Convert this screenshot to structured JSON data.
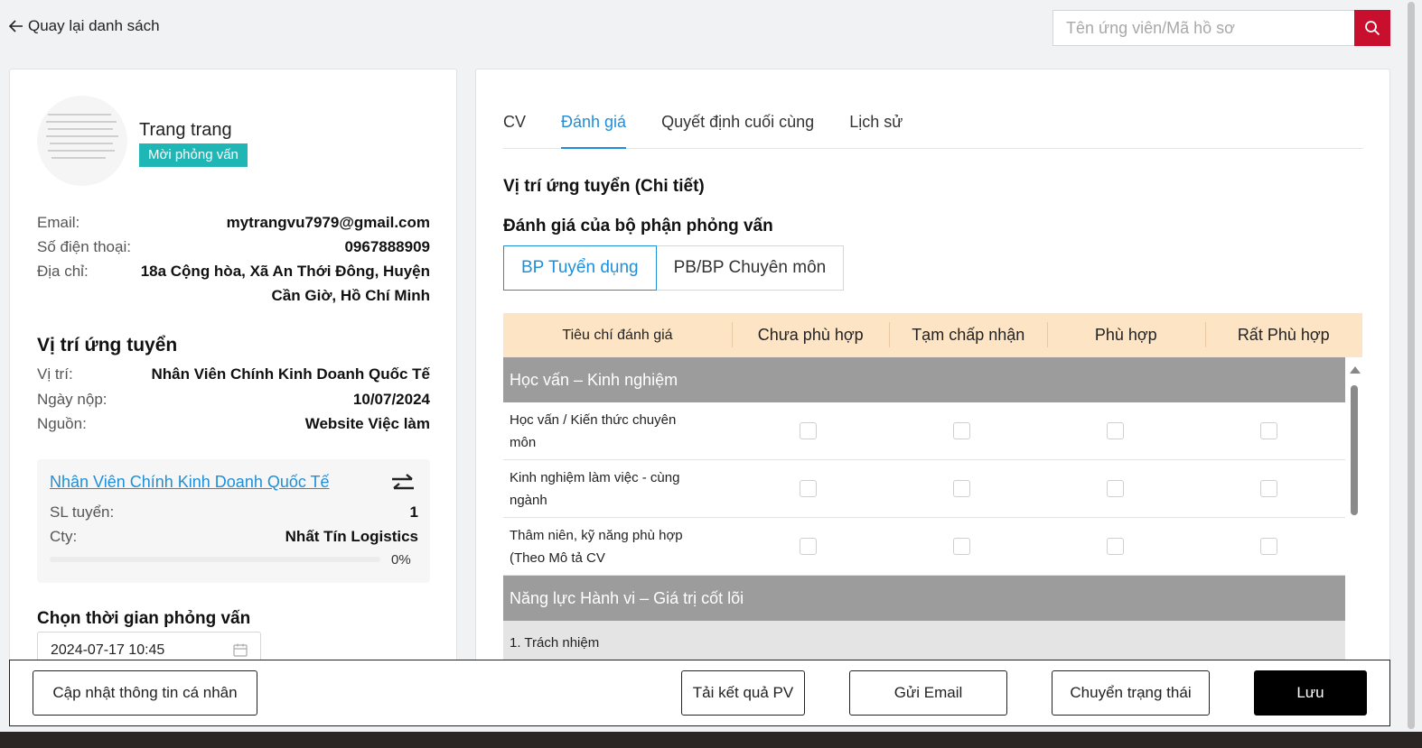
{
  "header": {
    "back_label": "Quay lại danh sách",
    "search_placeholder": "Tên ứng viên/Mã hồ sơ"
  },
  "candidate": {
    "name": "Trang trang",
    "status": "Mời phỏng vấn",
    "email_label": "Email:",
    "email": "mytrangvu7979@gmail.com",
    "phone_label": "Số điện thoại:",
    "phone": "0967888909",
    "address_label": "Địa chỉ:",
    "address_line1": "18a Cộng hòa, Xã An Thới Đông, Huyện",
    "address_line2": "Cần Giờ, Hồ Chí Minh"
  },
  "position": {
    "title": "Vị trí ứng tuyển",
    "role_label": "Vị trí:",
    "role": "Nhân Viên Chính Kinh Doanh Quốc Tế",
    "date_label": "Ngày nộp:",
    "date": "10/07/2024",
    "source_label": "Nguồn:",
    "source": "Website Việc làm"
  },
  "job_card": {
    "link": "Nhân Viên Chính Kinh Doanh Quốc Tế",
    "qty_label": "SL tuyển:",
    "qty": "1",
    "company_label": "Cty:",
    "company": "Nhất Tín Logistics",
    "progress_text": "0%",
    "progress_value": 0
  },
  "interview": {
    "title": "Chọn thời gian phỏng vấn",
    "datetime": "2024-07-17 10:45"
  },
  "tabs": [
    {
      "label": "CV",
      "active": false
    },
    {
      "label": "Đánh giá",
      "active": true
    },
    {
      "label": "Quyết định cuối cùng",
      "active": false
    },
    {
      "label": "Lịch sử",
      "active": false
    }
  ],
  "evaluation": {
    "heading1": "Vị trí ứng tuyển (Chi tiết)",
    "heading2": "Đánh giá của bộ phận phỏng vấn",
    "segments": [
      "BP Tuyển dụng",
      "PB/BP Chuyên môn"
    ],
    "columns": [
      "Tiêu chí đánh giá",
      "Chưa phù hợp",
      "Tạm chấp nhận",
      "Phù hợp",
      "Rất Phù hợp"
    ],
    "group1": "Học vấn – Kinh nghiệm",
    "criteria": [
      {
        "line1": "Học vấn / Kiến thức chuyên",
        "line2": "môn"
      },
      {
        "line1": "Kinh nghiệm làm việc - cùng",
        "line2": "ngành"
      },
      {
        "line1": "Thâm niên, kỹ năng phù hợp",
        "line2": "(Theo Mô tả CV"
      }
    ],
    "group2": "Năng lực Hành vi – Giá trị cốt lõi",
    "sub_item": "1. Trách nhiệm"
  },
  "footer": {
    "update_label": "Cập nhật thông tin cá nhân",
    "download_label": "Tải kết quả PV",
    "email_label": "Gửi Email",
    "status_label": "Chuyển trạng thái",
    "save_label": "Lưu"
  },
  "colors": {
    "accent": "#1e8fd8",
    "badge": "#1fb6b6",
    "search_button": "#c8102e",
    "table_header": "#fde4c4",
    "group_row": "#9c9c9c"
  }
}
